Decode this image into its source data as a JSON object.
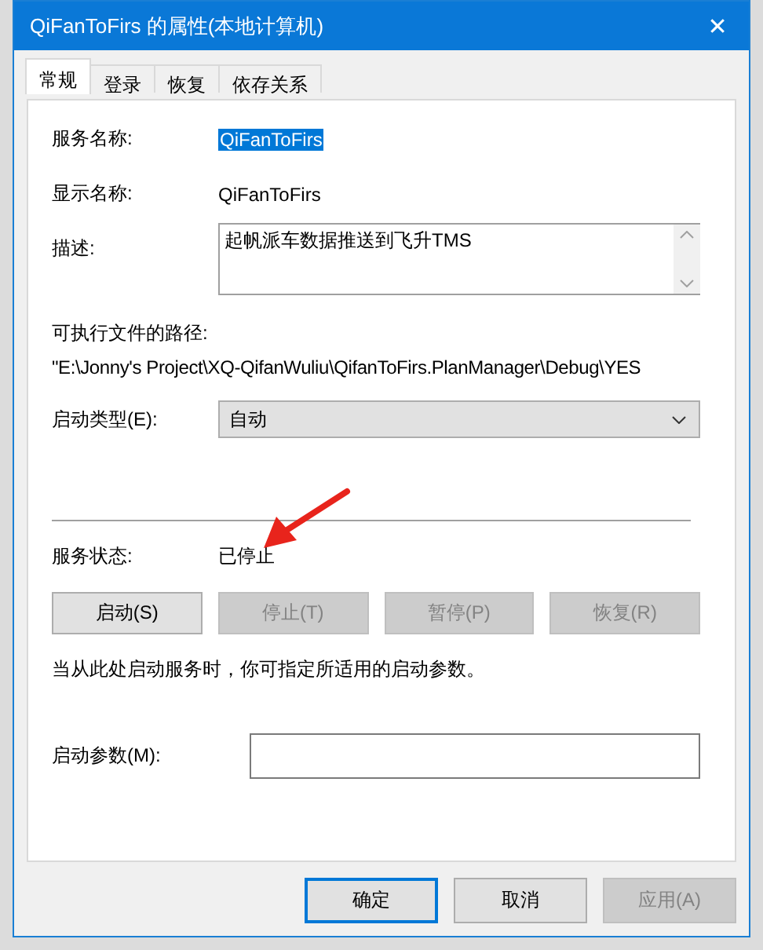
{
  "window": {
    "title": "QiFanToFirs 的属性(本地计算机)",
    "close": "✕"
  },
  "tabs": [
    {
      "label": "常规",
      "selected": true
    },
    {
      "label": "登录",
      "selected": false
    },
    {
      "label": "恢复",
      "selected": false
    },
    {
      "label": "依存关系",
      "selected": false
    }
  ],
  "general": {
    "service_name": {
      "label": "服务名称:",
      "value": "QiFanToFirs",
      "selected": true
    },
    "display_name": {
      "label": "显示名称:",
      "value": "QiFanToFirs"
    },
    "description": {
      "label": "描述:",
      "value": "起帆派车数据推送到飞升TMS"
    },
    "path": {
      "label": "可执行文件的路径:",
      "value": "\"E:\\Jonny's Project\\XQ-QifanWuliu\\QifanToFirs.PlanManager\\Debug\\YES"
    },
    "startup_type": {
      "label": "启动类型(E):",
      "value": "自动"
    },
    "status": {
      "label": "服务状态:",
      "value": "已停止"
    },
    "service_buttons": [
      {
        "label": "启动(S)",
        "disabled": false
      },
      {
        "label": "停止(T)",
        "disabled": true
      },
      {
        "label": "暂停(P)",
        "disabled": true
      },
      {
        "label": "恢复(R)",
        "disabled": true
      }
    ],
    "hint": "当从此处启动服务时，你可指定所适用的启动参数。",
    "start_params": {
      "label": "启动参数(M):"
    }
  },
  "annotations": [
    {
      "kind": "arrow"
    }
  ],
  "buttons": [
    {
      "label": "确定",
      "default": true,
      "disabled": false
    },
    {
      "label": "取消",
      "default": false,
      "disabled": false
    },
    {
      "label": "应用(A)",
      "default": false,
      "disabled": true
    }
  ]
}
